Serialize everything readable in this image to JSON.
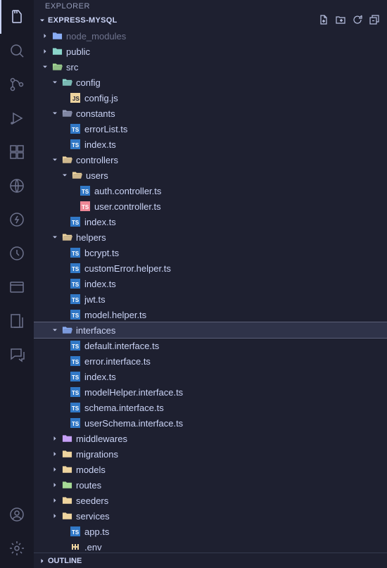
{
  "explorer": {
    "title": "EXPLORER",
    "project": "EXPRESS-MYSQL",
    "outline": "OUTLINE"
  },
  "tree": {
    "node_modules": "node_modules",
    "public": "public",
    "src": "src",
    "config": "config",
    "config_js": "config.js",
    "constants": "constants",
    "errorList_ts": "errorList.ts",
    "index_ts_1": "index.ts",
    "controllers": "controllers",
    "users": "users",
    "auth_controller_ts": "auth.controller.ts",
    "user_controller_ts": "user.controller.ts",
    "index_ts_2": "index.ts",
    "helpers": "helpers",
    "bcrypt_ts": "bcrypt.ts",
    "customError_helper_ts": "customError.helper.ts",
    "index_ts_3": "index.ts",
    "jwt_ts": "jwt.ts",
    "model_helper_ts": "model.helper.ts",
    "interfaces": "interfaces",
    "default_interface_ts": "default.interface.ts",
    "error_interface_ts": "error.interface.ts",
    "index_ts_4": "index.ts",
    "modelHelper_interface_ts": "modelHelper.interface.ts",
    "schema_interface_ts": "schema.interface.ts",
    "userSchema_interface_ts": "userSchema.interface.ts",
    "middlewares": "middlewares",
    "migrations": "migrations",
    "models": "models",
    "routes": "routes",
    "seeders": "seeders",
    "services": "services",
    "app_ts": "app.ts",
    "env": ".env"
  }
}
